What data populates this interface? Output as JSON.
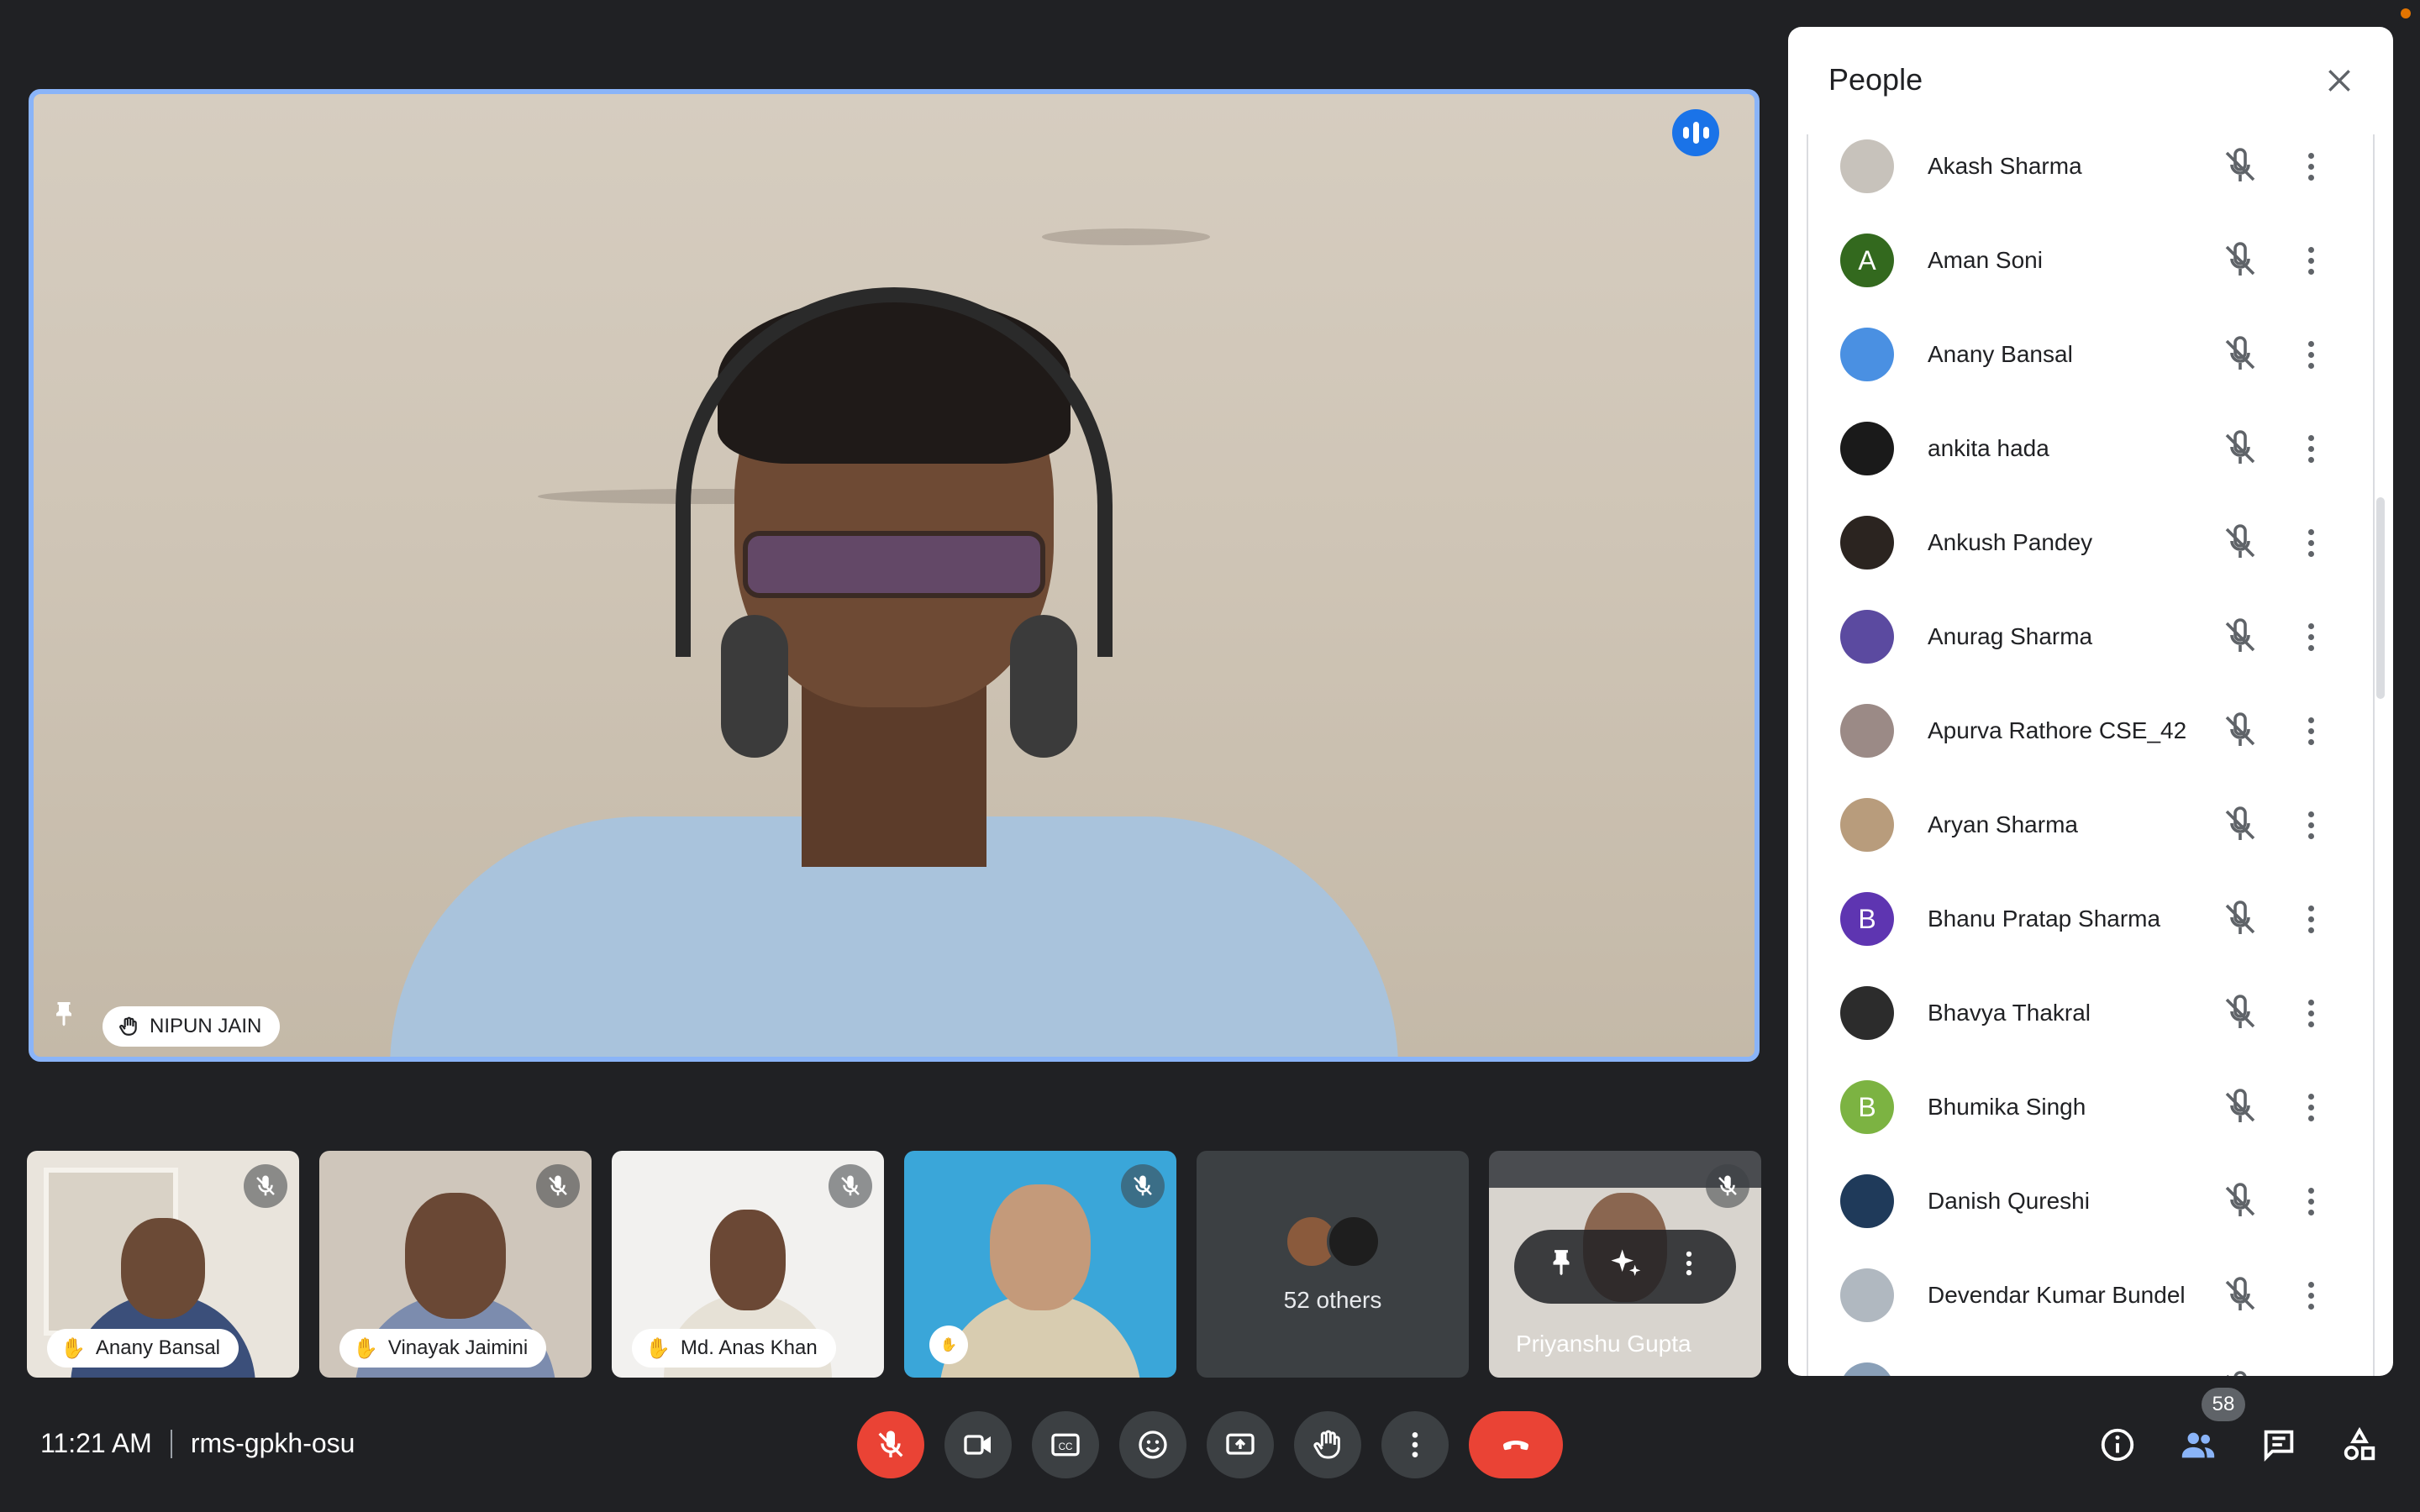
{
  "main_speaker": {
    "name": "NIPUN JAIN"
  },
  "filmstrip": [
    {
      "name": "Anany Bansal"
    },
    {
      "name": "Vinayak Jaimini"
    },
    {
      "name": "Md. Anas Khan"
    },
    {
      "name": ""
    },
    {
      "others_label": "52 others"
    },
    {
      "name": "Priyanshu Gupta"
    }
  ],
  "people_panel": {
    "title": "People",
    "participants": [
      {
        "name": "Akash Sharma",
        "avatar_color": "#c7c2bb"
      },
      {
        "name": "Aman Soni",
        "initial": "A",
        "avatar_color": "#33691e"
      },
      {
        "name": "Anany Bansal",
        "avatar_color": "#4a90e2"
      },
      {
        "name": "ankita hada",
        "avatar_color": "#1a1a1a"
      },
      {
        "name": "Ankush Pandey",
        "avatar_color": "#2b2420"
      },
      {
        "name": "Anurag Sharma",
        "avatar_color": "#5b4aa0"
      },
      {
        "name": "Apurva Rathore CSE_42",
        "avatar_color": "#9b8a86"
      },
      {
        "name": "Aryan Sharma",
        "avatar_color": "#b89c7c"
      },
      {
        "name": "Bhanu Pratap Sharma",
        "initial": "B",
        "avatar_color": "#5e35b1"
      },
      {
        "name": "Bhavya Thakral",
        "avatar_color": "#2c2c2c"
      },
      {
        "name": "Bhumika Singh",
        "initial": "B",
        "avatar_color": "#7cb342"
      },
      {
        "name": "Danish Qureshi",
        "avatar_color": "#1f3a5a"
      },
      {
        "name": "Devendar Kumar Bundel",
        "avatar_color": "#b0b8c0"
      },
      {
        "name": "Dinesh bhargav",
        "avatar_color": "#8aa0b8"
      }
    ]
  },
  "bottom_bar": {
    "time": "11:21 AM",
    "meeting_code": "rms-gpkh-osu",
    "participant_count": "58"
  },
  "colors": {
    "accent": "#8ab4f8",
    "end_call": "#ea4335",
    "bar_bg": "#3c4043"
  }
}
